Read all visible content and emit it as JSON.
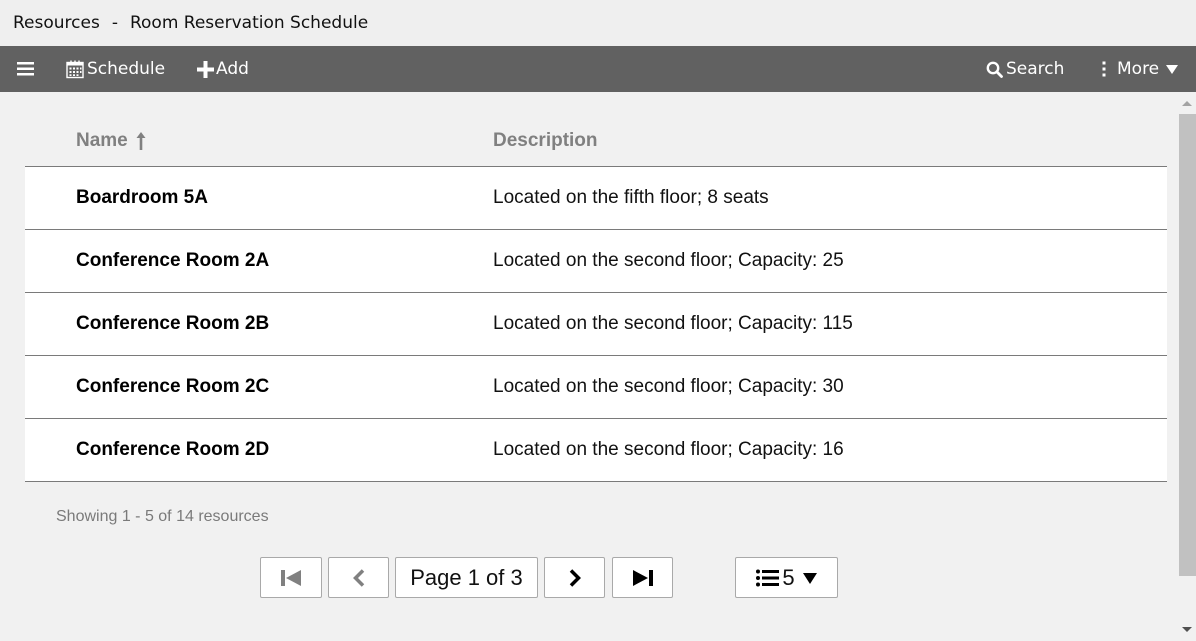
{
  "window": {
    "section": "Resources",
    "separator": "-",
    "app_title": "Room Reservation Schedule"
  },
  "toolbar": {
    "menu_icon": "hamburger-menu-icon",
    "schedule_label": "Schedule",
    "schedule_icon": "calendar-icon",
    "add_label": "Add",
    "add_icon": "plus-icon",
    "search_label": "Search",
    "search_icon": "search-icon",
    "more_label": "More",
    "more_icon": "vertical-dots-icon"
  },
  "table": {
    "columns": [
      {
        "label": "Name",
        "sort": "ascending"
      },
      {
        "label": "Description"
      }
    ],
    "rows": [
      {
        "name": "Boardroom 5A",
        "description": "Located on the fifth floor; 8 seats"
      },
      {
        "name": "Conference Room 2A",
        "description": "Located on the second floor; Capacity: 25"
      },
      {
        "name": "Conference Room 2B",
        "description": "Located on the second floor; Capacity: 115"
      },
      {
        "name": "Conference Room 2C",
        "description": "Located on the second floor; Capacity: 30"
      },
      {
        "name": "Conference Room 2D",
        "description": "Located on the second floor; Capacity: 16"
      }
    ]
  },
  "footer": {
    "showing_text": "Showing 1 - 5 of 14 resources"
  },
  "pager": {
    "page_label": "Page 1 of 3",
    "current_page": 1,
    "total_pages": 3,
    "page_size": "5",
    "first_enabled": false,
    "prev_enabled": false,
    "next_enabled": true,
    "last_enabled": true
  },
  "colors": {
    "toolbar_bg": "#616161",
    "title_bg": "#efefef",
    "content_bg": "#f1f1f1",
    "header_text": "#808080",
    "disabled_icon": "#808080"
  }
}
